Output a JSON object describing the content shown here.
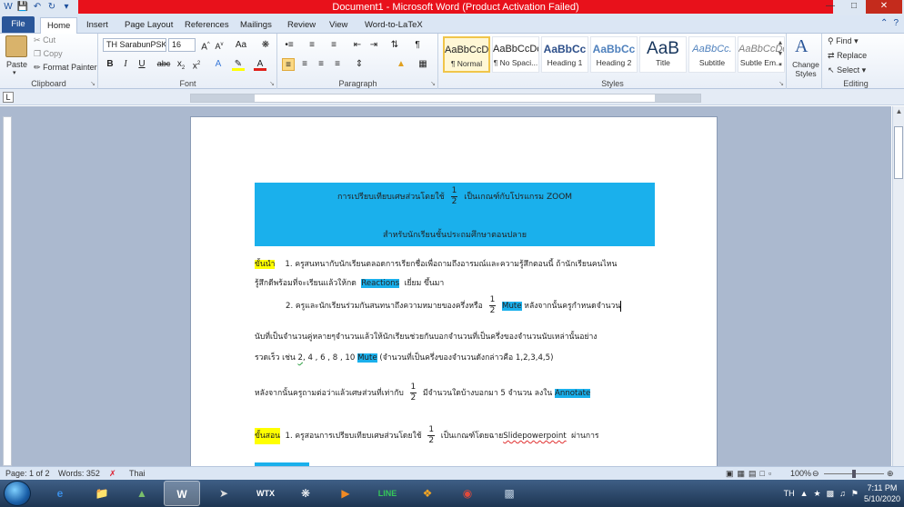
{
  "window": {
    "title": "Document1 - Microsoft Word (Product Activation Failed)"
  },
  "tabs": [
    {
      "label": "File"
    },
    {
      "label": "Home"
    },
    {
      "label": "Insert"
    },
    {
      "label": "Page Layout"
    },
    {
      "label": "References"
    },
    {
      "label": "Mailings"
    },
    {
      "label": "Review"
    },
    {
      "label": "View"
    },
    {
      "label": "Word-to-LaTeX"
    }
  ],
  "ribbon": {
    "clipboard": {
      "paste": "Paste",
      "cut": "Cut",
      "copy": "Copy",
      "format_painter": "Format Painter",
      "label": "Clipboard"
    },
    "font": {
      "name": "TH SarabunPSK",
      "size": "16",
      "label": "Font"
    },
    "paragraph": {
      "label": "Paragraph"
    },
    "styles": {
      "label": "Styles",
      "items": [
        {
          "preview": "AaBbCcDc",
          "name": "¶ Normal"
        },
        {
          "preview": "AaBbCcDc",
          "name": "¶ No Spaci..."
        },
        {
          "preview": "AaBbCc",
          "name": "Heading 1"
        },
        {
          "preview": "AaBbCc",
          "name": "Heading 2"
        },
        {
          "preview": "AaB",
          "name": "Title"
        },
        {
          "preview": "AaBbCc.",
          "name": "Subtitle"
        },
        {
          "preview": "AaBbCcDc",
          "name": "Subtle Em..."
        }
      ],
      "change_styles": "Change Styles"
    },
    "editing": {
      "find": "Find",
      "replace": "Replace",
      "select": "Select",
      "label": "Editing"
    }
  },
  "document": {
    "banner_line1_before": "การเปรียบเทียบเศษส่วนโดยใช้",
    "banner_line1_after": "เป็นเกณฑ์กับโปรแกรม  ZOOM",
    "banner_line2": "สำหรับนักเรียนชั้นประถมศึกษาตอนปลาย",
    "frac_num": "1",
    "frac_den": "2",
    "intro_label": "ขั้นนำ",
    "p1_text": "1. ครูสนทนากับนักเรียนตลอดการเรียกชื่อเพื่อถามถึงอารมณ์และความรู้สึกตอนนี้  ถ้านักเรียนคนไหน",
    "p1b_before": "รู้สึกดีพร้อมที่จะเรียนแล้วให้กด",
    "p1b_reactions": "Reactions",
    "p1b_after": "เยี่ยม ขึ้นมา",
    "p2_before": "2. ครูและนักเรียนร่วมกันสนทนาถึงความหมายของครึ่งหรือ",
    "p2_mute": "Mute",
    "p2_after": "หลังจากนั้นครูกำหนดจำนวน",
    "p3_text": "นับที่เป็นจำนวนคู่หลายๆจำนวนแล้วให้นักเรียนช่วยกันบอกจำนวนที่เป็นครึ่งของจำนวนนับเหล่านั้นอย่าง",
    "p4_before": "รวดเร็ว เช่น",
    "p4_two": "2",
    "p4_list": ", 4 , 6 , 8 , 10",
    "p4_mute": "Mute",
    "p4_after": "(จำนวนที่เป็นครึ่งของจำนวนดังกล่าวคือ  1,2,3,4,5)",
    "p5_before": "หลังจากนั้นครูถามต่อว่าแล้วเศษส่วนที่เท่ากับ",
    "p5_after": "มีจำนวนใดบ้างบอกมา  5  จำนวน ลงใน",
    "p5_annotate": "Annotate",
    "teach_label": "ขั้นสอน",
    "p6_before": "1. ครูสอนการเปรียบเทียบเศษส่วนโดยใช้",
    "p6_after": "เป็นเกณฑ์โดยฉาย",
    "p6_link": "Slidepowerpoint",
    "p6_end": "ผ่านการ"
  },
  "status": {
    "page": "Page: 1 of 2",
    "words": "Words: 352",
    "language": "Thai",
    "zoom": "100%"
  },
  "taskbar": {
    "lang": "TH",
    "time": "7:11 PM",
    "date": "5/10/2020"
  },
  "colors": {
    "highlight_blue": "#1ab0ec",
    "highlight_yellow": "#ffff00",
    "title_red": "#e8111b"
  }
}
